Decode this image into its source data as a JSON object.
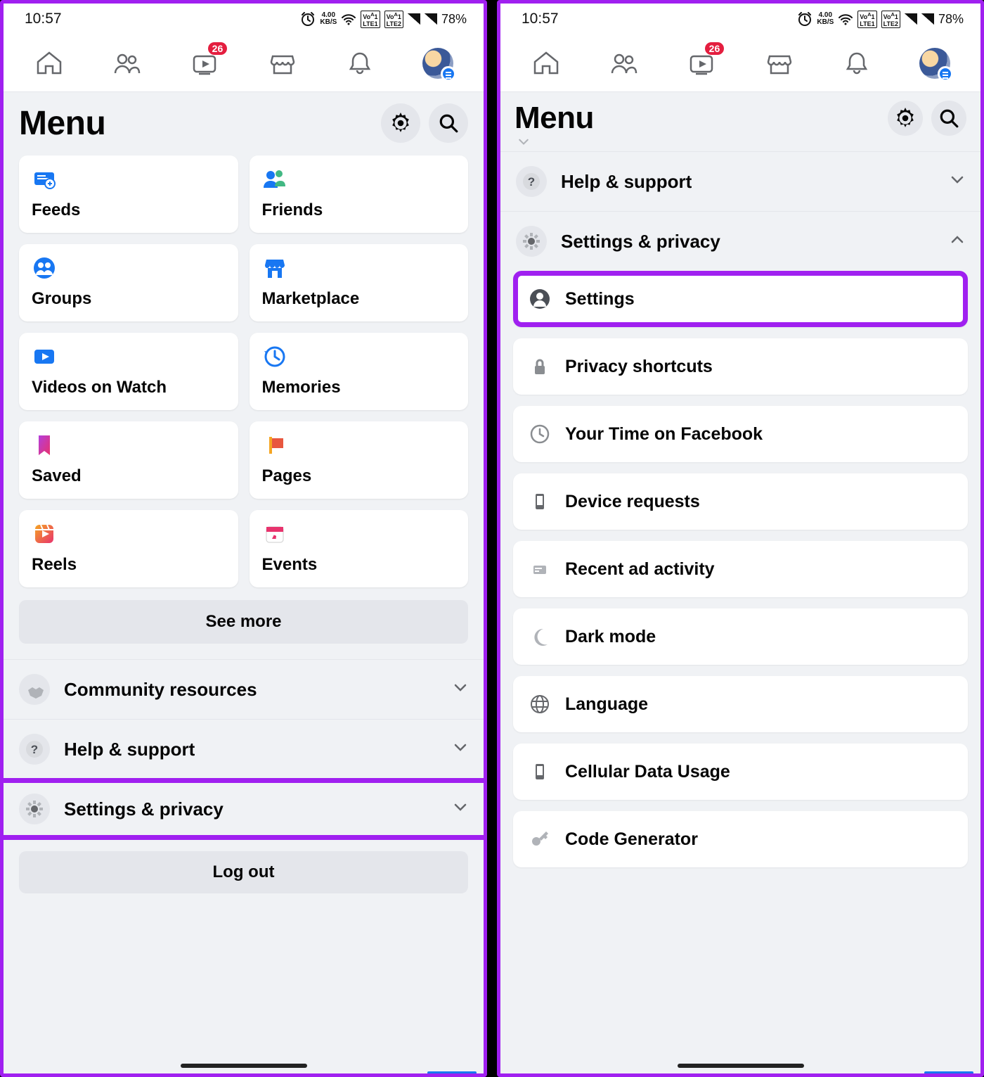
{
  "status": {
    "time": "10:57",
    "alarm": true,
    "net_speed_top": "4.00",
    "net_speed_bottom": "KB/S",
    "lte1": "Vo1 LTE1",
    "lte2": "Vo1 LTE2",
    "battery": "78%"
  },
  "nav": {
    "watch_badge": "26"
  },
  "header": {
    "title": "Menu"
  },
  "left": {
    "grid": [
      {
        "id": "feeds",
        "label": "Feeds"
      },
      {
        "id": "friends",
        "label": "Friends"
      },
      {
        "id": "groups",
        "label": "Groups"
      },
      {
        "id": "marketplace",
        "label": "Marketplace"
      },
      {
        "id": "videos",
        "label": "Videos on Watch"
      },
      {
        "id": "memories",
        "label": "Memories"
      },
      {
        "id": "saved",
        "label": "Saved"
      },
      {
        "id": "pages",
        "label": "Pages"
      },
      {
        "id": "reels",
        "label": "Reels"
      },
      {
        "id": "events",
        "label": "Events"
      }
    ],
    "see_more": "See more",
    "sections": {
      "community": "Community resources",
      "help": "Help & support",
      "settings": "Settings & privacy"
    },
    "logout": "Log out"
  },
  "right": {
    "sections": {
      "help": "Help & support",
      "settings": "Settings & privacy"
    },
    "items": [
      {
        "id": "settings",
        "label": "Settings"
      },
      {
        "id": "privacy",
        "label": "Privacy shortcuts"
      },
      {
        "id": "yourtime",
        "label": "Your Time on Facebook"
      },
      {
        "id": "device",
        "label": "Device requests"
      },
      {
        "id": "ads",
        "label": "Recent ad activity"
      },
      {
        "id": "dark",
        "label": "Dark mode"
      },
      {
        "id": "language",
        "label": "Language"
      },
      {
        "id": "cellular",
        "label": "Cellular Data Usage"
      },
      {
        "id": "codegen",
        "label": "Code Generator"
      }
    ]
  }
}
